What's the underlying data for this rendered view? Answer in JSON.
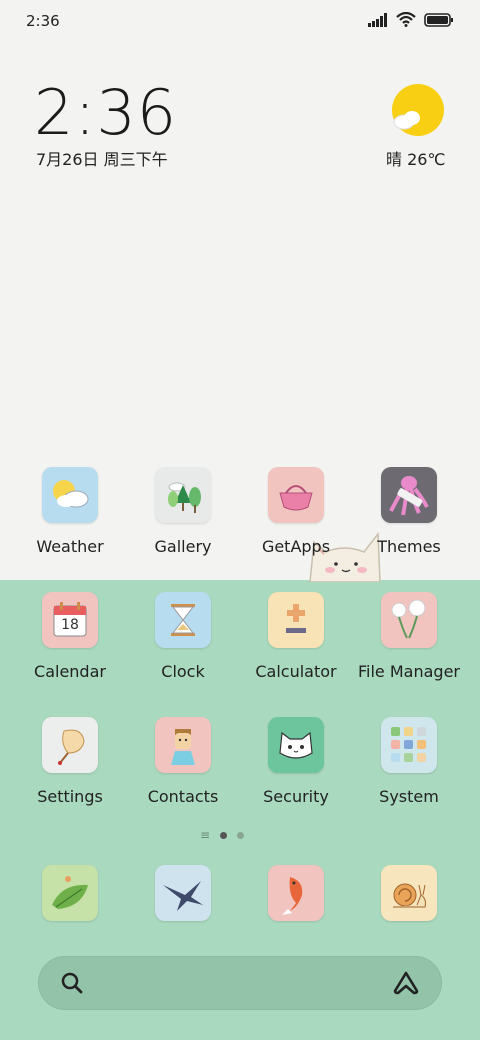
{
  "status_bar": {
    "time": "2:36"
  },
  "widget": {
    "clock": "2:36",
    "date": "7月26日 周三下午",
    "weather": "晴 26℃"
  },
  "apps": [
    {
      "label": "Weather"
    },
    {
      "label": "Gallery"
    },
    {
      "label": "GetApps"
    },
    {
      "label": "Themes"
    },
    {
      "label": "Calendar",
      "badge": "18"
    },
    {
      "label": "Clock"
    },
    {
      "label": "Calculator"
    },
    {
      "label": "File Manager"
    },
    {
      "label": "Settings"
    },
    {
      "label": "Contacts"
    },
    {
      "label": "Security"
    },
    {
      "label": "System"
    }
  ],
  "dock": [
    {
      "icon": "leaf-icon"
    },
    {
      "icon": "swallow-icon"
    },
    {
      "icon": "koi-fish-icon"
    },
    {
      "icon": "snail-icon"
    }
  ],
  "page_indicator": {
    "pages": 2,
    "current": 1
  },
  "colors": {
    "top_bg": "#f3f3f1",
    "bottom_bg": "#a9d9bf",
    "sun": "#f8cf12"
  }
}
